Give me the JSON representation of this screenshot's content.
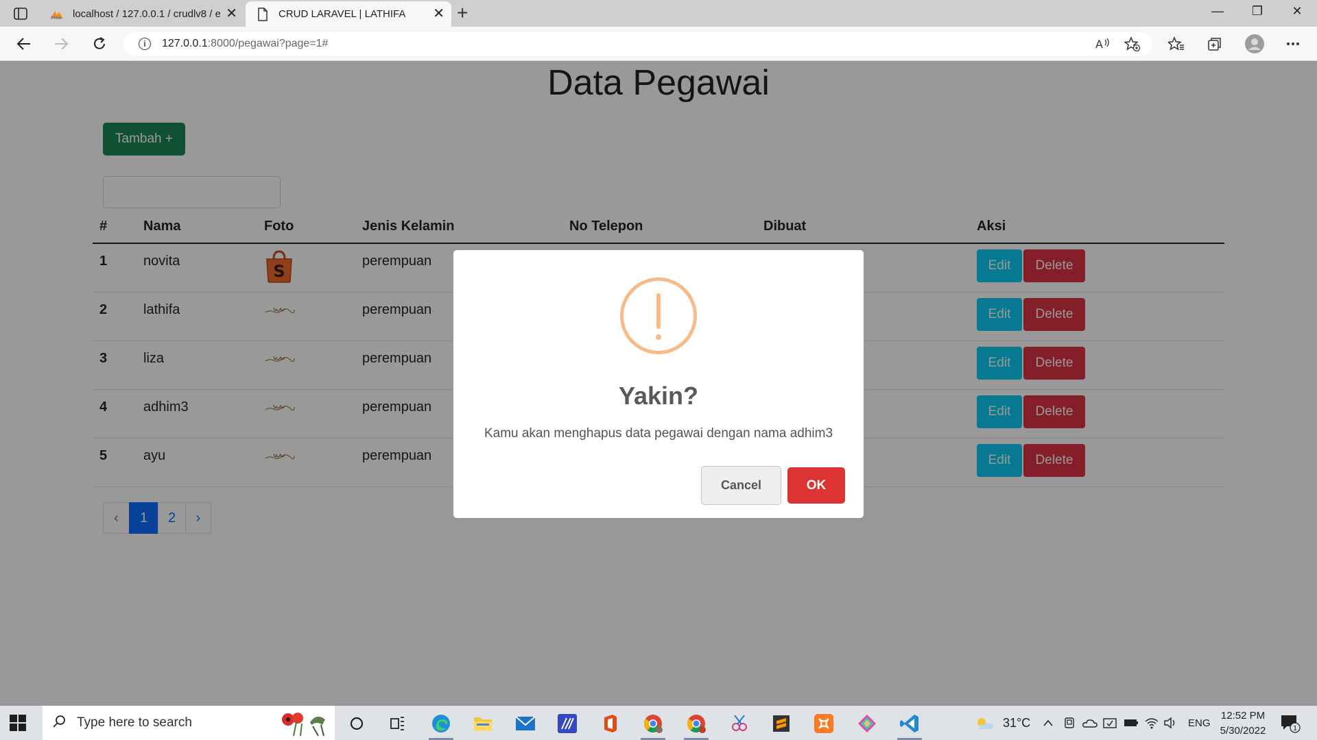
{
  "browser": {
    "tabs": [
      {
        "title": "localhost / 127.0.0.1 / crudlv8 / e",
        "favicon": "phpmyadmin-icon",
        "active": false
      },
      {
        "title": "CRUD LARAVEL | LATHIFA",
        "favicon": "document-icon",
        "active": true
      }
    ],
    "url_host": "127.0.0.1",
    "url_rest": ":8000/pegawai?page=1#"
  },
  "page": {
    "title": "Data Pegawai",
    "add_button": "Tambah +",
    "search_value": "",
    "table": {
      "headers": [
        "#",
        "Nama",
        "Foto",
        "Jenis Kelamin",
        "No Telepon",
        "Dibuat",
        "Aksi"
      ],
      "rows": [
        {
          "no": "1",
          "nama": "novita",
          "foto": "shopping-bag-icon",
          "jk": "perempuan"
        },
        {
          "no": "2",
          "nama": "lathifa",
          "foto": "signature-image",
          "jk": "perempuan"
        },
        {
          "no": "3",
          "nama": "liza",
          "foto": "signature-image",
          "jk": "perempuan"
        },
        {
          "no": "4",
          "nama": "adhim3",
          "foto": "signature-image",
          "jk": "perempuan"
        },
        {
          "no": "5",
          "nama": "ayu",
          "foto": "signature-image",
          "jk": "perempuan"
        }
      ],
      "edit_label": "Edit",
      "delete_label": "Delete"
    },
    "pagination": {
      "prev": "‹",
      "pages": [
        "1",
        "2"
      ],
      "active": "1",
      "next": "›"
    }
  },
  "modal": {
    "icon": "warning-icon",
    "title": "Yakin?",
    "text": "Kamu akan menghapus data pegawai dengan nama adhim3",
    "cancel": "Cancel",
    "ok": "OK"
  },
  "taskbar": {
    "search_placeholder": "Type here to search",
    "weather": "31°C",
    "language": "ENG",
    "time": "12:52 PM",
    "date": "5/30/2022",
    "notifications": "1"
  },
  "colors": {
    "success": "#198754",
    "info": "#0dcaf0",
    "danger": "#dc3545",
    "primary": "#0d6efd",
    "warning_icon": "#f8bb86",
    "ok_button": "#dd3333"
  }
}
